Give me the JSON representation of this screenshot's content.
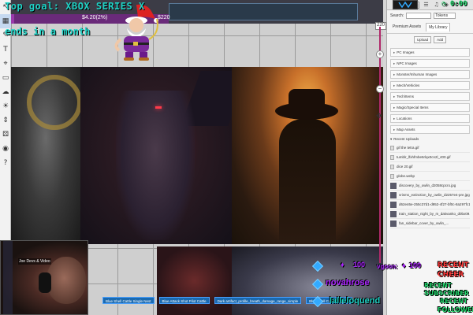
{
  "overlay": {
    "goal_text": "Top goal: XBOX SERIES X",
    "ends_text": "ends in a month",
    "goal_amount": "$4.20(2%)",
    "goal_target": "$220",
    "goal_progress": 0.02,
    "timer": "0:00",
    "alerts": {
      "cheer_amount_1": "100",
      "goon_label": "vgoon:",
      "goon_amount": "100",
      "name_1": "novahrose",
      "name_2": "lalleloquend",
      "recent_cheer_label": "RECENT",
      "recent_cheer_value": "CHEER",
      "recent_sub_label": "RECENT",
      "recent_sub_value": "SUBSCRIBER",
      "recent_follower_label": "RECENT",
      "recent_follower_value": "FOLLOWER"
    },
    "webcam_caption": "Joe Devs & Video"
  },
  "toolbar": {
    "tools": [
      {
        "name": "select-tool",
        "glyph": "↖"
      },
      {
        "name": "map-tool",
        "glyph": "▦"
      },
      {
        "name": "draw-tool",
        "glyph": "✎"
      },
      {
        "name": "text-tool",
        "glyph": "T"
      },
      {
        "name": "ping-tool",
        "glyph": "⌖"
      },
      {
        "name": "shape-tool",
        "glyph": "▭"
      },
      {
        "name": "fog-tool",
        "glyph": "☁"
      },
      {
        "name": "light-tool",
        "glyph": "☀"
      },
      {
        "name": "measure-tool",
        "glyph": "⇕"
      },
      {
        "name": "dice-tool",
        "glyph": "⚄"
      },
      {
        "name": "token-tool",
        "glyph": "◉"
      },
      {
        "name": "help-tool",
        "glyph": "?"
      }
    ]
  },
  "zoom": {
    "label": "220",
    "plus": "+",
    "minus": "−"
  },
  "panel": {
    "search_label": "Search:",
    "filter_value": "Tokens",
    "tabs": [
      "premium_assets",
      "my_library"
    ],
    "tab_labels": {
      "premium": "Premium Assets",
      "library": "My Library"
    },
    "buttons": {
      "upload": "Upload",
      "add": "Add"
    },
    "folders": [
      "PC Images",
      "NPC Images",
      "Monster/Inhuman Images",
      "Mech/Vehicles",
      "Tech/Items",
      "Magic/Special Items",
      "Locations",
      "Map Assets"
    ],
    "recent_uploads_label": "Recent Uploads",
    "files": [
      {
        "name": "gif the tetra.gif",
        "thumb": false
      },
      {
        "name": "tumblr_lfxhfmbe5rlqx0cn2l_400.gif",
        "thumb": false
      },
      {
        "name": "dice 20.gif",
        "thumb": false
      },
      {
        "name": "globe.webp",
        "thumb": false
      },
      {
        "name": "discovery_by_owlin_d2058cpcro.jpg",
        "thumb": true
      },
      {
        "name": "vrisms_extinction_by_owlin_d2257e4-pre.jpg",
        "thumb": true
      },
      {
        "name": "d62e46e-255c37d1-d952-4f27-bf0c-8a297fc1f5a.jpg",
        "thumb": true
      },
      {
        "name": "train_station_night_by_m_dakvanko_d0bx09...",
        "thumb": true
      },
      {
        "name": "fan_sidebar_cover_by_owlin_...",
        "thumb": true
      }
    ]
  },
  "chips": [
    "Blue Shell Cattle Single Nest",
    "Blue Attack Shot Pilot Cattle",
    "Dark artifact_profile_breath_damage_range_simple",
    "Blue Shell Cattle Single..."
  ],
  "colors": {
    "overlay_teal": "#1fd3c6",
    "overlay_green": "#1fd36a",
    "overlay_red": "#ff3a3a",
    "overlay_purple": "#aa22ff",
    "zoom_track": "#b02a6a"
  }
}
